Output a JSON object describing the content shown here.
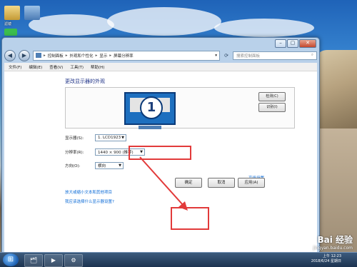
{
  "desktop": {
    "icon_label": "滤镜"
  },
  "window": {
    "caption_buttons": [
      "–",
      "▢",
      "✕"
    ],
    "breadcrumb": [
      "控制面板",
      "外观和个性化",
      "显示",
      "屏幕分辨率"
    ],
    "search_placeholder": "搜索控制面板",
    "menu": [
      "文件(F)",
      "编辑(E)",
      "查看(V)",
      "工具(T)",
      "帮助(H)"
    ]
  },
  "content": {
    "heading": "更改显示器的外观",
    "monitor_number": "1",
    "detect_button": "检测(C)",
    "identify_button": "识别(I)",
    "display_label": "显示器(S):",
    "display_value": "1. LCD1923",
    "resolution_label": "分辨率(R):",
    "resolution_value": "1440 × 900 (推荐)",
    "orientation_label": "方向(O):",
    "orientation_value": "横向",
    "advanced_link": "高级设置",
    "link_text_size": "放大或缩小文本和其他项目",
    "link_which_settings": "我应该选择什么显示器设置?",
    "ok_button": "确定",
    "cancel_button": "取消",
    "apply_button": "应用(A)"
  },
  "taskbar": {
    "start_glyph": "⊞",
    "items": [
      "🗂",
      "▶",
      "⚙"
    ],
    "time": "上午 12:23",
    "date": "2018/6/24 星期日"
  },
  "watermark": {
    "brand": "Bai 经验",
    "url": "jingyan.baidu.com"
  },
  "colors": {
    "annotation": "#e23a3a",
    "link": "#0a6ad6",
    "heading": "#1e3287"
  }
}
